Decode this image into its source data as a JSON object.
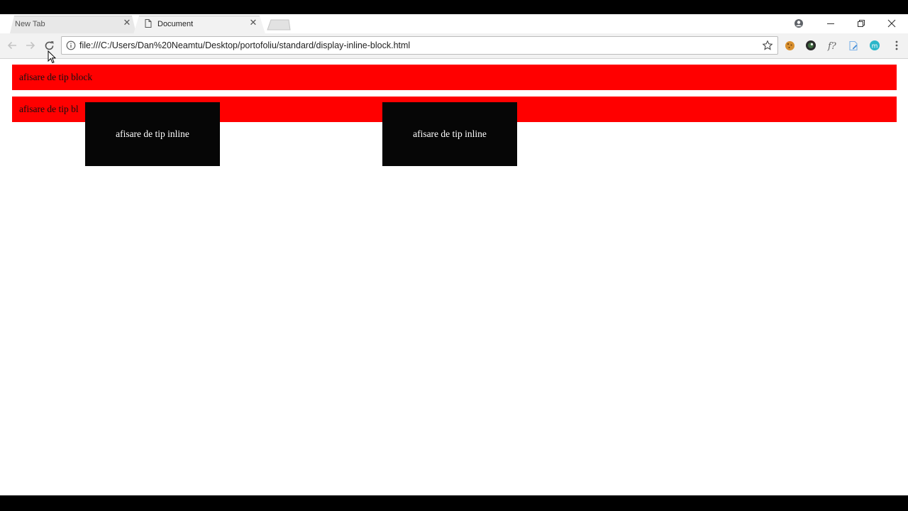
{
  "tabs": [
    {
      "label": "New Tab",
      "active": false
    },
    {
      "label": "Document",
      "active": true
    }
  ],
  "address_bar": {
    "url": "file:///C:/Users/Dan%20Neamtu/Desktop/portofoliu/standard/display-inline-block.html"
  },
  "page": {
    "block_1": "afisare de tip block",
    "block_2": "afisare de tip bl",
    "inline_1": "afisare de tip inline",
    "inline_2": "afisare de tip inline"
  },
  "colors": {
    "block_bg": "#ff0000",
    "inline_bg": "#060606",
    "inline_text": "#ffffff"
  },
  "icons": {
    "back": "arrow-left-icon",
    "forward": "arrow-right-icon",
    "reload": "reload-icon",
    "info": "info-icon",
    "bookmark": "star-icon",
    "profile": "profile-icon",
    "minimize": "minimize-icon",
    "restore": "restore-icon",
    "close": "close-icon",
    "menu": "kebab-menu-icon"
  }
}
